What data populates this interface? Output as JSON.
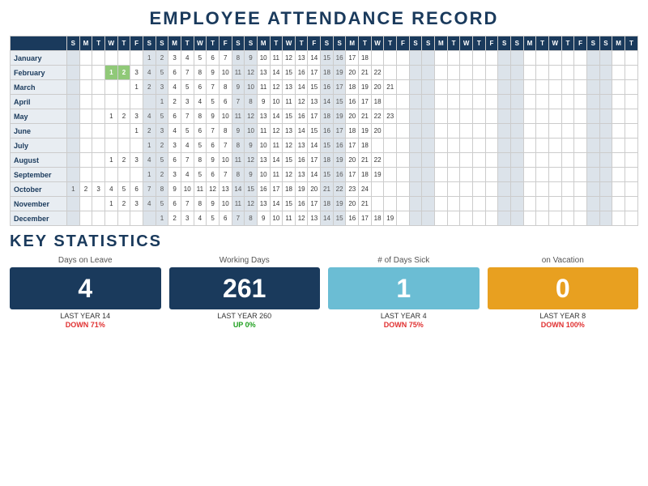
{
  "title": "EMPLOYEE ATTENDANCE RECORD",
  "stats_title": "KEY STATISTICS",
  "header": {
    "month_col": "",
    "day_headers": [
      "S",
      "M",
      "T",
      "W",
      "T",
      "F",
      "S",
      "S",
      "M",
      "T",
      "W",
      "T",
      "F",
      "S",
      "S",
      "M",
      "T",
      "W",
      "T",
      "F",
      "S",
      "S",
      "M",
      "T",
      "W",
      "T",
      "F",
      "S",
      "S",
      "M",
      "T",
      "W",
      "T",
      "F",
      "S",
      "S",
      "M",
      "T",
      "W",
      "T",
      "F",
      "S",
      "S",
      "M",
      "T"
    ]
  },
  "months": [
    {
      "name": "January",
      "days": [
        "",
        "",
        "",
        "",
        "",
        "",
        "1",
        "2",
        "3",
        "4",
        "5",
        "6",
        "7",
        "8",
        "9",
        "10",
        "11",
        "12",
        "13",
        "14",
        "15",
        "16",
        "17",
        "18",
        "",
        "",
        "",
        "",
        "",
        "",
        "",
        "",
        "",
        "",
        "",
        "",
        "",
        "",
        "",
        "",
        "",
        "",
        "",
        "",
        "",
        ""
      ],
      "highlight": [
        7
      ]
    },
    {
      "name": "February",
      "days": [
        "",
        "",
        "",
        "1",
        "2",
        "3",
        "4",
        "5",
        "6",
        "7",
        "8",
        "9",
        "10",
        "11",
        "12",
        "13",
        "14",
        "15",
        "16",
        "17",
        "18",
        "19",
        "20",
        "21",
        "22",
        "",
        "",
        "",
        "",
        "",
        "",
        "",
        "",
        "",
        "",
        "",
        "",
        "",
        "",
        "",
        "",
        "",
        "",
        "",
        ""
      ],
      "highlight": [
        3,
        4
      ]
    },
    {
      "name": "March",
      "days": [
        "",
        "",
        "",
        "",
        "",
        "1",
        "2",
        "3",
        "4",
        "5",
        "6",
        "7",
        "8",
        "9",
        "10",
        "11",
        "12",
        "13",
        "14",
        "15",
        "16",
        "17",
        "18",
        "19",
        "20",
        "21",
        "",
        "",
        "",
        "",
        "",
        "",
        "",
        "",
        "",
        "",
        "",
        "",
        "",
        "",
        "",
        "",
        "",
        "",
        ""
      ]
    },
    {
      "name": "April",
      "days": [
        "",
        "",
        "",
        "",
        "",
        "",
        "",
        "1",
        "2",
        "3",
        "4",
        "5",
        "6",
        "7",
        "8",
        "9",
        "10",
        "11",
        "12",
        "13",
        "14",
        "15",
        "16",
        "17",
        "18",
        "",
        "",
        "",
        "",
        "",
        "",
        "",
        "",
        "",
        "",
        "",
        "",
        "",
        "",
        "",
        "",
        "",
        "",
        "",
        ""
      ]
    },
    {
      "name": "May",
      "days": [
        "",
        "",
        "",
        "1",
        "2",
        "3",
        "4",
        "5",
        "6",
        "7",
        "8",
        "9",
        "10",
        "11",
        "12",
        "13",
        "14",
        "15",
        "16",
        "17",
        "18",
        "19",
        "20",
        "21",
        "22",
        "23",
        "",
        "",
        "",
        "",
        "",
        "",
        "",
        "",
        "",
        "",
        "",
        "",
        "",
        "",
        "",
        "",
        "",
        "",
        ""
      ]
    },
    {
      "name": "June",
      "days": [
        "",
        "",
        "",
        "",
        "",
        "1",
        "2",
        "3",
        "4",
        "5",
        "6",
        "7",
        "8",
        "9",
        "10",
        "11",
        "12",
        "13",
        "14",
        "15",
        "16",
        "17",
        "18",
        "19",
        "20",
        "",
        "",
        "",
        "",
        "",
        "",
        "",
        "",
        "",
        "",
        "",
        "",
        "",
        "",
        "",
        "",
        "",
        "",
        "",
        ""
      ]
    },
    {
      "name": "July",
      "days": [
        "",
        "",
        "",
        "",
        "",
        "",
        "1",
        "2",
        "3",
        "4",
        "5",
        "6",
        "7",
        "8",
        "9",
        "10",
        "11",
        "12",
        "13",
        "14",
        "15",
        "16",
        "17",
        "18",
        "",
        "",
        "",
        "",
        "",
        "",
        "",
        "",
        "",
        "",
        "",
        "",
        "",
        "",
        "",
        "",
        "",
        "",
        "",
        ""
      ]
    },
    {
      "name": "August",
      "days": [
        "",
        "",
        "",
        "1",
        "2",
        "3",
        "4",
        "5",
        "6",
        "7",
        "8",
        "9",
        "10",
        "11",
        "12",
        "13",
        "14",
        "15",
        "16",
        "17",
        "18",
        "19",
        "20",
        "21",
        "22",
        "",
        "",
        "",
        "",
        "",
        "",
        "",
        "",
        "",
        "",
        "",
        "",
        "",
        "",
        "",
        "",
        "",
        "",
        "",
        ""
      ]
    },
    {
      "name": "September",
      "days": [
        "",
        "",
        "",
        "",
        "",
        "",
        "1",
        "2",
        "3",
        "4",
        "5",
        "6",
        "7",
        "8",
        "9",
        "10",
        "11",
        "12",
        "13",
        "14",
        "15",
        "16",
        "17",
        "18",
        "19",
        "",
        "",
        "",
        "",
        "",
        "",
        "",
        "",
        "",
        "",
        "",
        "",
        "",
        "",
        "",
        "",
        "",
        "",
        "",
        ""
      ]
    },
    {
      "name": "October",
      "days": [
        "1",
        "2",
        "3",
        "4",
        "5",
        "6",
        "7",
        "8",
        "9",
        "10",
        "11",
        "12",
        "13",
        "14",
        "15",
        "16",
        "17",
        "18",
        "19",
        "20",
        "21",
        "22",
        "23",
        "24",
        "",
        "",
        "",
        "",
        "",
        "",
        "",
        "",
        "",
        "",
        "",
        "",
        "",
        "",
        "",
        "",
        "",
        "",
        "",
        "",
        ""
      ]
    },
    {
      "name": "November",
      "days": [
        "",
        "",
        "",
        "1",
        "2",
        "3",
        "4",
        "5",
        "6",
        "7",
        "8",
        "9",
        "10",
        "11",
        "12",
        "13",
        "14",
        "15",
        "16",
        "17",
        "18",
        "19",
        "20",
        "21",
        "",
        "",
        "",
        "",
        "",
        "",
        "",
        "",
        "",
        "",
        "",
        "",
        "",
        "",
        "",
        "",
        "",
        "",
        "",
        ""
      ]
    },
    {
      "name": "December",
      "days": [
        "",
        "",
        "",
        "",
        "",
        "",
        "",
        "1",
        "2",
        "3",
        "4",
        "5",
        "6",
        "7",
        "8",
        "9",
        "10",
        "11",
        "12",
        "13",
        "14",
        "15",
        "16",
        "17",
        "18",
        "19",
        "",
        "",
        "",
        "",
        "",
        "",
        "",
        "",
        "",
        "",
        "",
        "",
        "",
        "",
        "",
        "",
        "",
        "",
        "",
        ""
      ]
    }
  ],
  "stats": [
    {
      "label": "Days on Leave",
      "value": "4",
      "box_class": "dark",
      "last_year": "LAST YEAR  14",
      "change": "DOWN 71%",
      "change_dir": "down"
    },
    {
      "label": "Working Days",
      "value": "261",
      "box_class": "dark",
      "last_year": "LAST YEAR 260",
      "change": "UP 0%",
      "change_dir": "up"
    },
    {
      "label": "# of Days Sick",
      "value": "1",
      "box_class": "blue",
      "last_year": "LAST YEAR 4",
      "change": "DOWN 75%",
      "change_dir": "down"
    },
    {
      "label": "on Vacation",
      "value": "0",
      "box_class": "orange",
      "last_year": "LAST YEAR 8",
      "change": "DOWN 100%",
      "change_dir": "down"
    }
  ]
}
